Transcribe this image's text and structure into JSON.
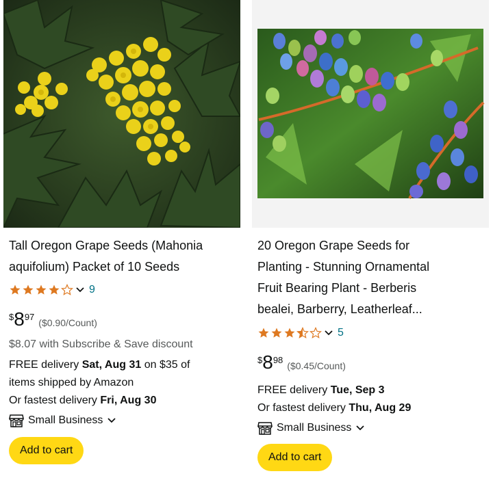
{
  "products": [
    {
      "title_lines": [
        "Tall Oregon Grape Seeds (Mahonia",
        "aquifolium) Packet of 10 Seeds"
      ],
      "rating": 4.0,
      "review_count": "9",
      "price": {
        "currency": "$",
        "whole": "8",
        "fraction": "97",
        "unit_price": "($0.90/Count)"
      },
      "subscribe_save": "$8.07 with Subscribe & Save discount",
      "delivery": [
        {
          "prefix": "FREE delivery ",
          "bold": "Sat, Aug 31",
          "suffix": " on $35 of"
        },
        {
          "prefix": "items shipped by Amazon",
          "bold": "",
          "suffix": ""
        },
        {
          "prefix": "Or fastest delivery ",
          "bold": "Fri, Aug 30",
          "suffix": ""
        }
      ],
      "badge": "Small Business",
      "cart_label": "Add to cart",
      "image": "yellow mahonia flowers"
    },
    {
      "title_lines": [
        "20 Oregon Grape Seeds for",
        "Planting - Stunning Ornamental",
        "Fruit Bearing Plant - Berberis",
        "bealei, Barberry, Leatherleaf..."
      ],
      "rating": 3.5,
      "review_count": "5",
      "price": {
        "currency": "$",
        "whole": "8",
        "fraction": "98",
        "unit_price": "($0.45/Count)"
      },
      "delivery": [
        {
          "prefix": "FREE delivery ",
          "bold": "Tue, Sep 3",
          "suffix": ""
        },
        {
          "prefix": "Or fastest delivery ",
          "bold": "Thu, Aug 29",
          "suffix": ""
        }
      ],
      "badge": "Small Business",
      "cart_label": "Add to cart",
      "image": "blue oregon grape berries"
    }
  ],
  "colors": {
    "star": "#de7921",
    "link": "#007185",
    "cart_button": "#ffd814",
    "secondary_text": "#565959"
  }
}
